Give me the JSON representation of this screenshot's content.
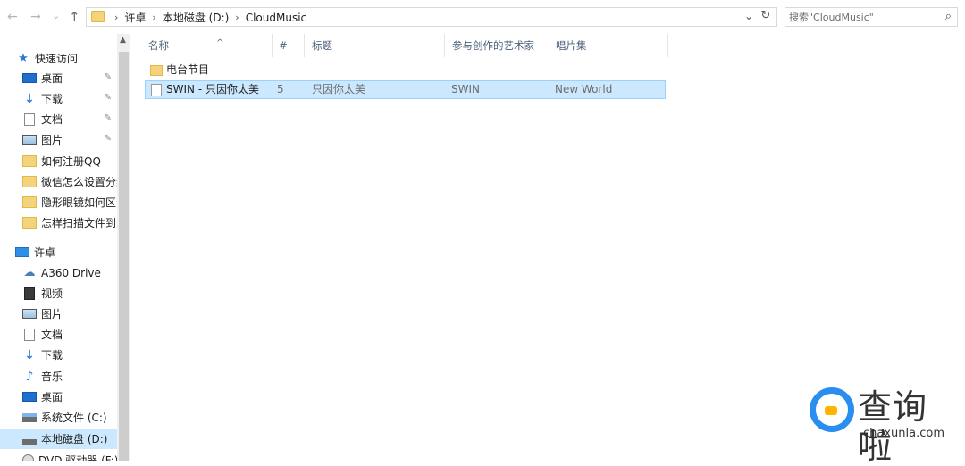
{
  "address_bar": {
    "back_glyph": "←",
    "forward_glyph": "→",
    "history_glyph": "⌄",
    "up_glyph": "↑",
    "crumbs": [
      "许卓",
      "本地磁盘 (D:)",
      "CloudMusic"
    ],
    "separator": "›",
    "dropdown_glyph": "⌄",
    "refresh_glyph": "↻"
  },
  "search": {
    "placeholder": "搜索\"CloudMusic\"",
    "icon_glyph": "⌕"
  },
  "nav": {
    "scroll_up_glyph": "▲",
    "quick_access": {
      "label": "快速访问",
      "items": [
        {
          "label": "桌面",
          "icon": "desktop-icon",
          "pinned": true
        },
        {
          "label": "下载",
          "icon": "download-icon",
          "pinned": true
        },
        {
          "label": "文档",
          "icon": "document-icon",
          "pinned": true
        },
        {
          "label": "图片",
          "icon": "pictures-icon",
          "pinned": true
        },
        {
          "label": "如何注册QQ",
          "icon": "folder-icon",
          "pinned": false
        },
        {
          "label": "微信怎么设置分组",
          "icon": "folder-icon",
          "pinned": false
        },
        {
          "label": "隐形眼镜如何区分",
          "icon": "folder-icon",
          "pinned": false
        },
        {
          "label": "怎样扫描文件到电脑",
          "icon": "folder-icon",
          "pinned": false
        }
      ],
      "pin_glyph": "✎"
    },
    "this_pc": {
      "label": "许卓",
      "items": [
        {
          "label": "A360 Drive",
          "icon": "cloud-drive-icon"
        },
        {
          "label": "视频",
          "icon": "video-icon"
        },
        {
          "label": "图片",
          "icon": "pictures-icon"
        },
        {
          "label": "文档",
          "icon": "document-icon"
        },
        {
          "label": "下载",
          "icon": "download-icon"
        },
        {
          "label": "音乐",
          "icon": "music-icon"
        },
        {
          "label": "桌面",
          "icon": "desktop-icon"
        },
        {
          "label": "系统文件 (C:)",
          "icon": "system-drive-icon"
        },
        {
          "label": "本地磁盘 (D:)",
          "icon": "drive-icon",
          "selected": true
        },
        {
          "label": "DVD 驱动器 (F:)",
          "icon": "dvd-drive-icon"
        }
      ]
    }
  },
  "columns": {
    "name": "名称",
    "number": "#",
    "title": "标题",
    "artists": "参与创作的艺术家",
    "album": "唱片集",
    "sort_glyph": "^"
  },
  "files": [
    {
      "name": "电台节目",
      "type": "folder",
      "number": "",
      "title": "",
      "artists": "",
      "album": ""
    },
    {
      "name": "SWIN - 只因你太美",
      "type": "file",
      "number": "5",
      "title": "只因你太美",
      "artists": "SWIN",
      "album": "New World",
      "selected": true
    }
  ],
  "watermark": {
    "text": "查询啦",
    "domain": "chaxunla.com"
  },
  "colors": {
    "selection_bg": "#cce8ff",
    "selection_border": "#99d1ff",
    "folder": "#f4d37d",
    "accent_blue": "#2a7ad6"
  }
}
